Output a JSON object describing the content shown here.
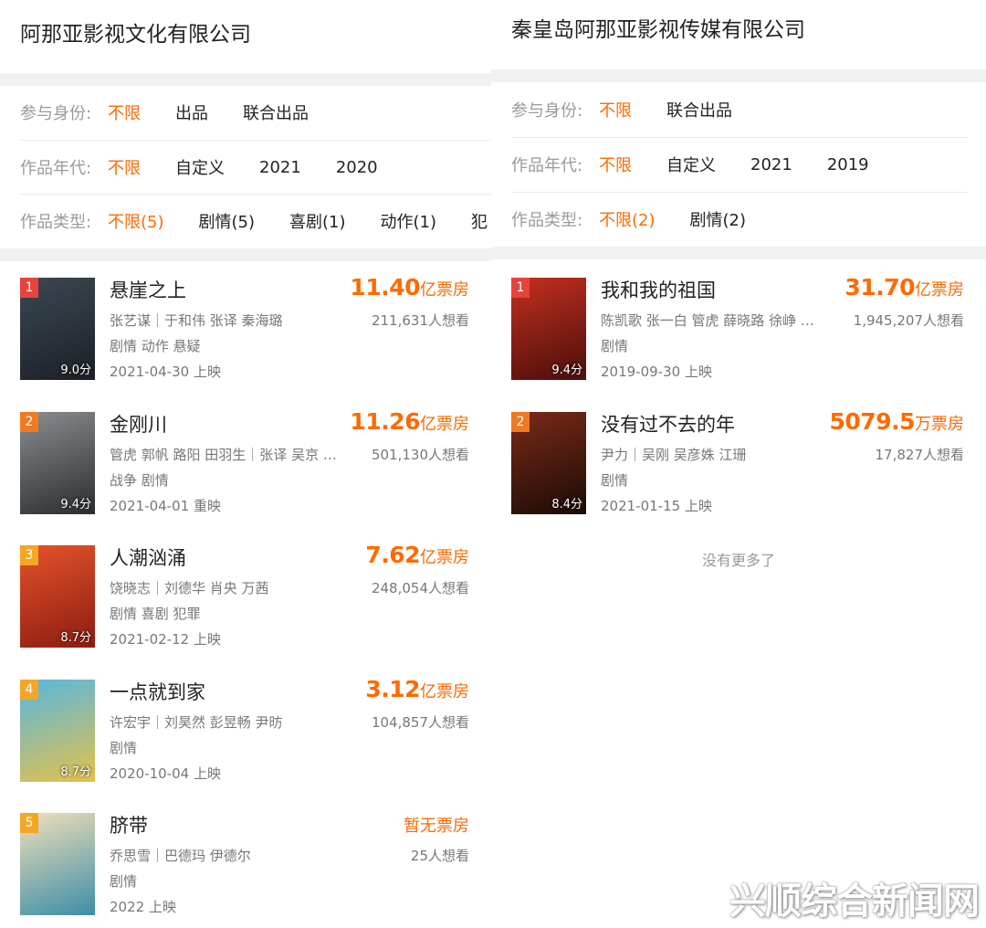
{
  "left": {
    "company": "阿那亚影视文化有限公司",
    "filters": [
      {
        "label": "参与身份:",
        "options": [
          {
            "text": "不限",
            "active": true
          },
          {
            "text": "出品"
          },
          {
            "text": "联合出品"
          }
        ]
      },
      {
        "label": "作品年代:",
        "options": [
          {
            "text": "不限",
            "active": true
          },
          {
            "text": "自定义"
          },
          {
            "text": "2021"
          },
          {
            "text": "2020"
          }
        ]
      },
      {
        "label": "作品类型:",
        "options": [
          {
            "text": "不限(5)",
            "active": true
          },
          {
            "text": "剧情(5)"
          },
          {
            "text": "喜剧(1)"
          },
          {
            "text": "动作(1)"
          },
          {
            "text": "犯"
          }
        ]
      }
    ],
    "movies": [
      {
        "rank": "1",
        "rank_color": "#e8433b",
        "score": "9.0分",
        "title": "悬崖之上",
        "cast": "张艺谋｜于和伟 张译 秦海璐",
        "genre": "剧情 动作 悬疑",
        "date": "2021-04-30 上映",
        "box_num": "11.40",
        "box_unit": "亿票房",
        "want": "211,631人想看",
        "poster_colors": [
          "#3d4752",
          "#1b2027"
        ]
      },
      {
        "rank": "2",
        "rank_color": "#f07a22",
        "score": "9.4分",
        "title": "金刚川",
        "cast": "管虎  郭帆  路阳  田羽生｜张译 吴京 …",
        "genre": "战争 剧情",
        "date": "2021-04-01 重映",
        "box_num": "11.26",
        "box_unit": "亿票房",
        "want": "501,130人想看",
        "poster_colors": [
          "#8a8d90",
          "#2b2e31"
        ]
      },
      {
        "rank": "3",
        "rank_color": "#f5a623",
        "score": "8.7分",
        "title": "人潮汹涌",
        "cast": "饶晓志｜刘德华 肖央 万茜",
        "genre": "剧情 喜剧 犯罪",
        "date": "2021-02-12 上映",
        "box_num": "7.62",
        "box_unit": "亿票房",
        "want": "248,054人想看",
        "poster_colors": [
          "#e5532a",
          "#8b1c12"
        ]
      },
      {
        "rank": "4",
        "rank_color": "#f5a623",
        "score": "8.7分",
        "title": "一点就到家",
        "cast": "许宏宇｜刘昊然 彭昱畅 尹昉",
        "genre": "剧情",
        "date": "2020-10-04 上映",
        "box_num": "3.12",
        "box_unit": "亿票房",
        "want": "104,857人想看",
        "poster_colors": [
          "#55b7e0",
          "#e6c14a"
        ]
      },
      {
        "rank": "5",
        "rank_color": "#f5a623",
        "score": "",
        "title": "脐带",
        "cast": "乔思雪｜巴德玛 伊德尔",
        "genre": "剧情",
        "date": "2022 上映",
        "box_text": "暂无票房",
        "want": "25人想看",
        "poster_colors": [
          "#f1dfb8",
          "#3d8ea8"
        ]
      }
    ]
  },
  "right": {
    "company": "秦皇岛阿那亚影视传媒有限公司",
    "filters": [
      {
        "label": "参与身份:",
        "options": [
          {
            "text": "不限",
            "active": true
          },
          {
            "text": "联合出品"
          }
        ]
      },
      {
        "label": "作品年代:",
        "options": [
          {
            "text": "不限",
            "active": true
          },
          {
            "text": "自定义"
          },
          {
            "text": "2021"
          },
          {
            "text": "2019"
          }
        ]
      },
      {
        "label": "作品类型:",
        "options": [
          {
            "text": "不限(2)",
            "active": true
          },
          {
            "text": "剧情(2)"
          }
        ]
      }
    ],
    "movies": [
      {
        "rank": "1",
        "rank_color": "#e8433b",
        "score": "9.4分",
        "title": "我和我的祖国",
        "cast": "陈凯歌  张一白  管虎  薛晓路  徐峥 …",
        "genre": "剧情",
        "date": "2019-09-30 上映",
        "box_num": "31.70",
        "box_unit": "亿票房",
        "want": "1,945,207人想看",
        "poster_colors": [
          "#c4301f",
          "#4a0e0a"
        ]
      },
      {
        "rank": "2",
        "rank_color": "#f07a22",
        "score": "8.4分",
        "title": "没有过不去的年",
        "cast": "尹力｜吴刚 吴彦姝 江珊",
        "genre": "剧情",
        "date": "2021-01-15 上映",
        "box_num": "5079.5",
        "box_unit": "万票房",
        "want": "17,827人想看",
        "poster_colors": [
          "#7a2a18",
          "#1b0b06"
        ]
      }
    ],
    "no_more": "没有更多了"
  },
  "watermark": "兴顺综合新闻网"
}
